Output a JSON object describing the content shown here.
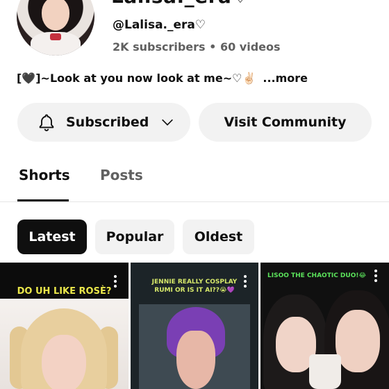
{
  "channel": {
    "name_partial": "Lalisa._era♡",
    "handle": "@Lalisa._era♡",
    "stats": "2K subscribers • 60 videos",
    "bio": "[🖤]~Look at you now look at me~♡✌🏻",
    "bio_more": "...more"
  },
  "actions": {
    "subscribed_label": "Subscribed",
    "community_label": "Visit Community"
  },
  "tabs": [
    {
      "label": "Shorts",
      "selected": true
    },
    {
      "label": "Posts",
      "selected": false
    }
  ],
  "filters": [
    {
      "label": "Latest",
      "selected": true
    },
    {
      "label": "Popular",
      "selected": false
    },
    {
      "label": "Oldest",
      "selected": false
    }
  ],
  "shorts": [
    {
      "caption": "DO UH LIKE ROSÈ?"
    },
    {
      "caption": "JENNIE REALLY COSPLAY RUMI OR IS IT AI??😭💜"
    },
    {
      "caption": "LISOO THE CHAOTIC DUO!😂"
    }
  ],
  "colors": {
    "accent_dark": "#0f0f0f",
    "secondary_text": "#606060",
    "chip_bg": "#f2f2f2"
  },
  "icons": [
    "bell-icon",
    "chevron-down-icon",
    "more-vert-icon"
  ]
}
